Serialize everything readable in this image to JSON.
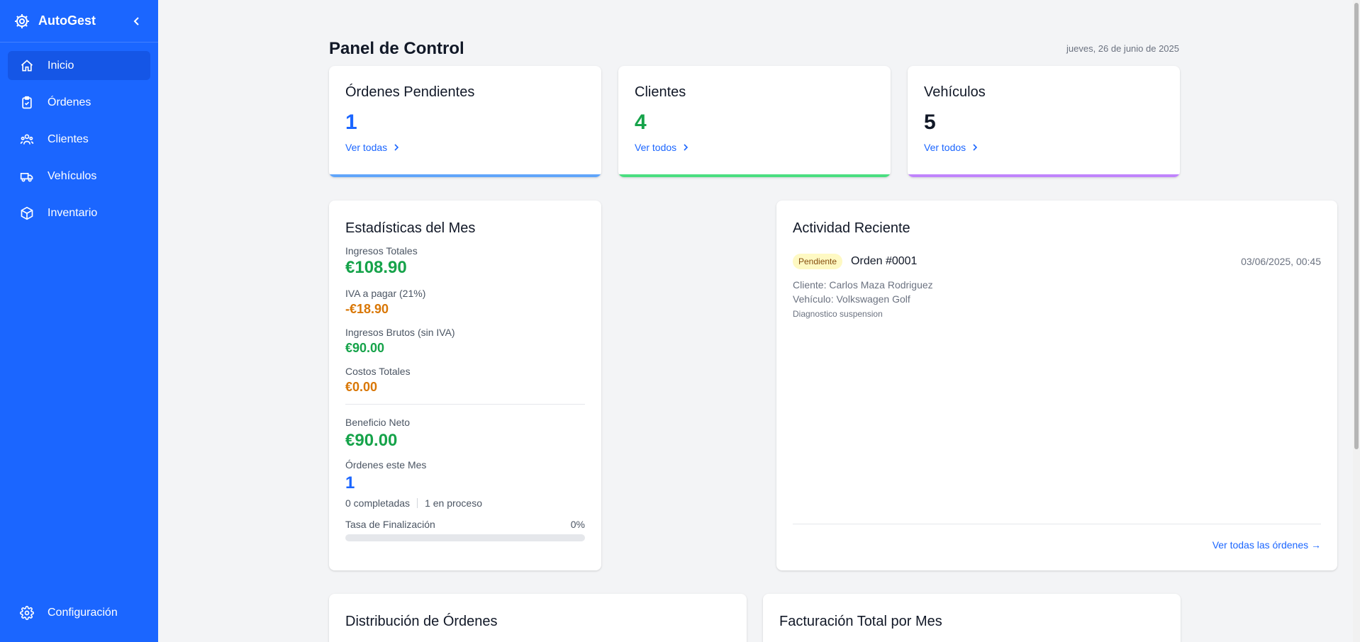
{
  "app": {
    "name": "AutoGest"
  },
  "sidebar": {
    "items": [
      {
        "label": "Inicio",
        "icon": "home-icon",
        "active": true
      },
      {
        "label": "Órdenes",
        "icon": "clipboard-icon"
      },
      {
        "label": "Clientes",
        "icon": "users-icon"
      },
      {
        "label": "Vehículos",
        "icon": "truck-icon"
      },
      {
        "label": "Inventario",
        "icon": "box-icon"
      }
    ],
    "settings": {
      "label": "Configuración",
      "icon": "gear-icon"
    }
  },
  "header": {
    "title": "Panel de Control",
    "date": "jueves, 26 de junio de 2025"
  },
  "stats": [
    {
      "title": "Órdenes Pendientes",
      "value": "1",
      "link": "Ver todas",
      "color": "#1b66ff",
      "bar": "#60a5fa"
    },
    {
      "title": "Clientes",
      "value": "4",
      "link": "Ver todos",
      "color": "#16a34a",
      "bar": "#4ade80"
    },
    {
      "title": "Vehículos",
      "value": "5",
      "link": "Ver todos",
      "color": "#111827",
      "bar": "#c084fc"
    }
  ],
  "monthly": {
    "title": "Estadísticas del Mes",
    "total_income_label": "Ingresos Totales",
    "total_income": "€108.90",
    "vat_label": "IVA a pagar (21%)",
    "vat": "-€18.90",
    "gross_label": "Ingresos Brutos (sin IVA)",
    "gross": "€90.00",
    "costs_label": "Costos Totales",
    "costs": "€0.00",
    "net_label": "Beneficio Neto",
    "net": "€90.00",
    "orders_label": "Órdenes este Mes",
    "orders": "1",
    "completed": "0 completadas",
    "in_progress": "1 en proceso",
    "rate_label": "Tasa de Finalización",
    "rate": "0%",
    "rate_value": 0
  },
  "activity": {
    "title": "Actividad Reciente",
    "item": {
      "status": "Pendiente",
      "order": "Orden #0001",
      "time": "03/06/2025, 00:45",
      "client": "Cliente: Carlos Maza Rodriguez",
      "vehicle": "Vehículo: Volkswagen Golf",
      "description": "Diagnostico suspension"
    },
    "view_all": "Ver todas las órdenes →"
  },
  "bottom": {
    "left_title": "Distribución de Órdenes",
    "right_title": "Facturación Total por Mes"
  }
}
